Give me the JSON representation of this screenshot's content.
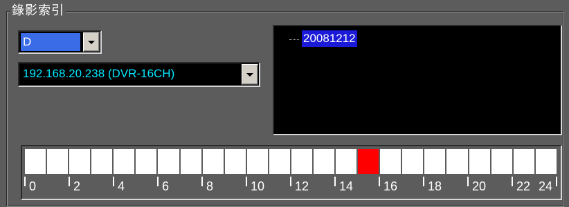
{
  "panel": {
    "title": "錄影索引"
  },
  "drive_select": {
    "value": "D"
  },
  "device_select": {
    "value": "192.168.20.238 (DVR-16CH)"
  },
  "date_tree": {
    "nodes": [
      "20081212"
    ]
  },
  "timeline": {
    "hours_total": 24,
    "cell_count": 24,
    "recorded_cells": [
      15
    ],
    "labels": [
      "0",
      "2",
      "4",
      "6",
      "8",
      "10",
      "12",
      "14",
      "16",
      "18",
      "20",
      "22",
      "24"
    ],
    "colors": {
      "empty": "#ffffff",
      "recorded": "#ff0000"
    }
  }
}
